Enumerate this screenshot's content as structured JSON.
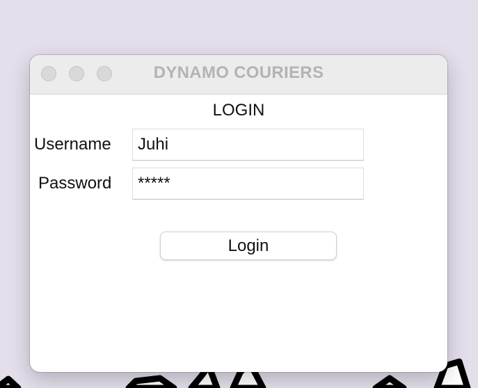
{
  "window": {
    "title": "DYNAMO COURIERS"
  },
  "form": {
    "heading": "LOGIN",
    "username_label": "Username",
    "username_value": "Juhi",
    "password_label": "Password",
    "password_value": "*****",
    "login_button_label": "Login"
  },
  "colors": {
    "desktop_background": "#e4dfeb",
    "titlebar_background": "#ececec",
    "title_text": "#b3b3b3",
    "traffic_light_inactive": "#d9d9d9"
  },
  "icons": {
    "close": "close-traffic-light-icon",
    "minimize": "minimize-traffic-light-icon",
    "zoom": "zoom-traffic-light-icon"
  }
}
